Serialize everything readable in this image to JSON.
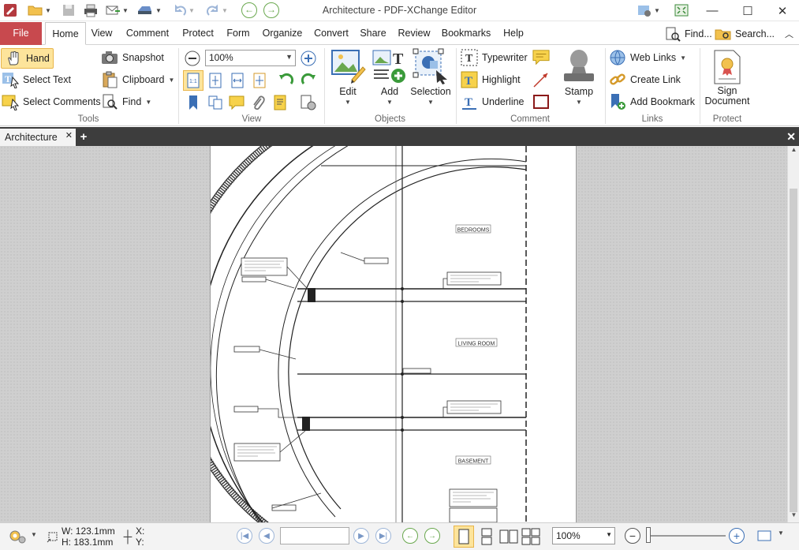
{
  "app": {
    "title": "Architecture - PDF-XChange Editor"
  },
  "menu": {
    "file": "File",
    "tabs": [
      "Home",
      "View",
      "Comment",
      "Protect",
      "Form",
      "Organize",
      "Convert",
      "Share",
      "Review",
      "Bookmarks",
      "Help"
    ],
    "active_tab": "Home",
    "find": "Find...",
    "search": "Search..."
  },
  "ribbon": {
    "tools": {
      "hand": "Hand",
      "select_text": "Select Text",
      "select_comments": "Select Comments",
      "snapshot": "Snapshot",
      "clipboard": "Clipboard",
      "find": "Find",
      "label": "Tools"
    },
    "view": {
      "zoom": "100%",
      "label": "View"
    },
    "objects": {
      "edit": "Edit",
      "add": "Add",
      "selection": "Selection",
      "label": "Objects"
    },
    "comment": {
      "typewriter": "Typewriter",
      "highlight": "Highlight",
      "underline": "Underline",
      "stamp": "Stamp",
      "label": "Comment"
    },
    "links": {
      "web_links": "Web Links",
      "create_link": "Create Link",
      "add_bookmark": "Add Bookmark",
      "label": "Links"
    },
    "protect": {
      "sign_line1": "Sign",
      "sign_line2": "Document",
      "label": "Protect"
    }
  },
  "document": {
    "tab_name": "Architecture",
    "rooms": [
      "BEDROOMS",
      "LIVING ROOM",
      "BASEMENT"
    ]
  },
  "status": {
    "width": "W: 123.1mm",
    "height": "H: 183.1mm",
    "x": "X:",
    "y": "Y:",
    "page_input": "",
    "zoom": "100%"
  },
  "colors": {
    "file_tab": "#c8494e",
    "hand_active": "#fde49b",
    "doc_strip": "#3d3d3d"
  }
}
